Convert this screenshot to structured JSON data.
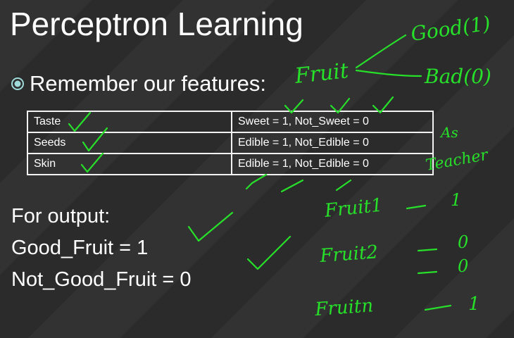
{
  "slide": {
    "title": "Perceptron Learning",
    "bullet": {
      "icon": "circle-bullet-icon",
      "text": "Remember our features:"
    },
    "features_table": {
      "rows": [
        {
          "feature": "Taste",
          "encoding": "Sweet = 1, Not_Sweet = 0"
        },
        {
          "feature": "Seeds",
          "encoding": "Edible = 1, Not_Edible = 0"
        },
        {
          "feature": "Skin",
          "encoding": "Edible = 1, Not_Edible = 0"
        }
      ]
    },
    "output": {
      "heading": "For output:",
      "good": "Good_Fruit = 1",
      "not_good": "Not_Good_Fruit = 0"
    }
  },
  "annotations": {
    "fruit": "Fruit",
    "good": "Good(1)",
    "bad": "Bad(0)",
    "as": "As",
    "teacher": "Teacher",
    "fruit1": "Fruit1",
    "fruit2": "Fruit2",
    "fruitn": "Fruitn",
    "label_1a": "1",
    "label_0a": "0",
    "label_0b": "0",
    "label_1b": "1"
  },
  "colors": {
    "background": "#2b2b2b",
    "text": "#ffffff",
    "ink": "#27e02a",
    "accent": "#9fd9d9"
  }
}
